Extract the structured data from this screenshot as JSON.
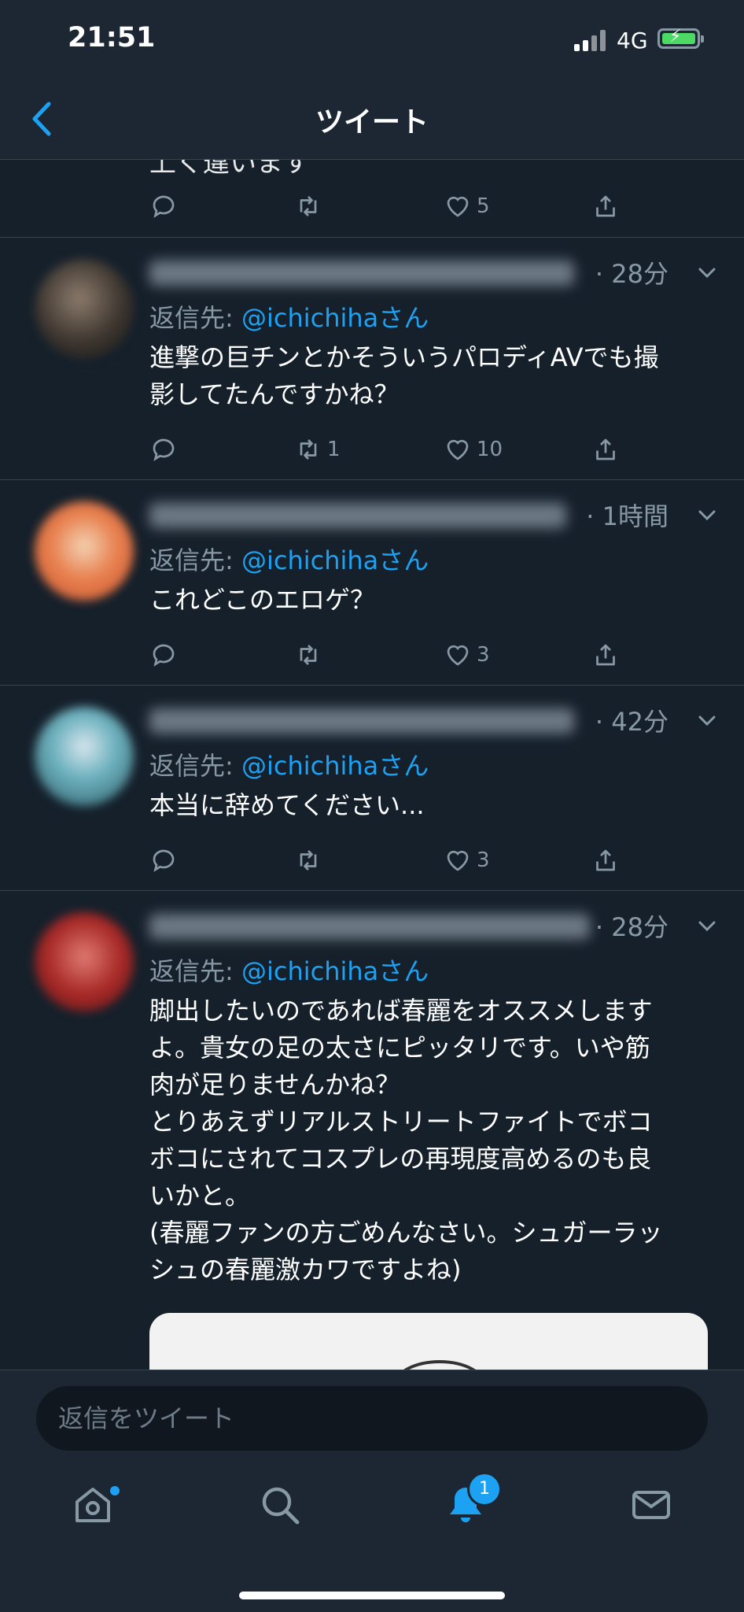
{
  "status": {
    "time": "21:51",
    "network": "4G"
  },
  "nav": {
    "title": "ツイート"
  },
  "thread_top": {
    "cut_text": "上く違います",
    "likes": "5"
  },
  "tweets": [
    {
      "time": "· 28分",
      "reply_prefix": "返信先: ",
      "reply_handle": "@ichichihaさん",
      "text": "進撃の巨チンとかそういうパロディAVでも撮\n影してたんですかね？",
      "retweets": "1",
      "likes": "10"
    },
    {
      "time": "· 1時間",
      "reply_prefix": "返信先: ",
      "reply_handle": "@ichichihaさん",
      "text": "これどこのエロゲ？",
      "retweets": "",
      "likes": "3"
    },
    {
      "time": "· 42分",
      "reply_prefix": "返信先: ",
      "reply_handle": "@ichichihaさん",
      "text": "本当に辞めてください...",
      "retweets": "",
      "likes": "3"
    },
    {
      "time": "· 28分",
      "reply_prefix": "返信先: ",
      "reply_handle": "@ichichihaさん",
      "text": "脚出したいのであれば春麗をオススメします\nよ。貴女の足の太さにピッタリです。いや筋\n肉が足りませんかね？\nとりあえずリアルストリートファイトでボコ\nボコにされてコスプレの再現度高めるのも良\nいかと。\n(春麗ファンの方ごめんなさい。シュガーラッ\nシュの春麗激カワですよね)"
    }
  ],
  "reply_bar": {
    "placeholder": "返信をツイート"
  },
  "tabbar": {
    "notifications_badge": "1"
  },
  "colors": {
    "background": "#15202b",
    "bar": "#1c2733",
    "accent": "#1da1f2",
    "muted": "#8899a6",
    "divider": "#38444d"
  },
  "icons": [
    "back-chevron-icon",
    "reply-icon",
    "retweet-icon",
    "like-icon",
    "share-icon",
    "caret-down-icon",
    "home-icon",
    "search-icon",
    "notifications-icon",
    "messages-icon"
  ]
}
